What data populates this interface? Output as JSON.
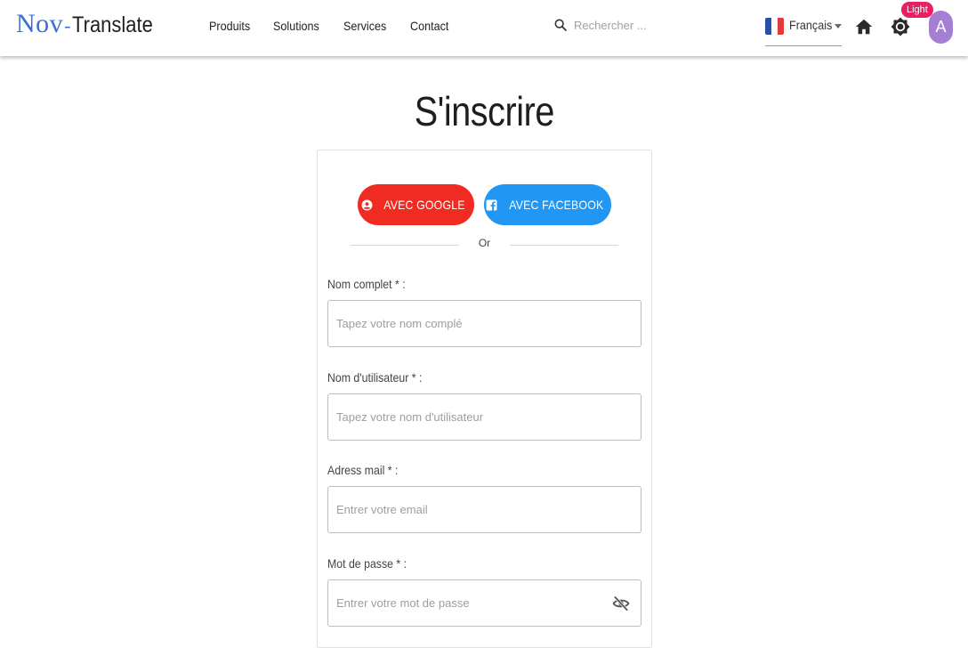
{
  "header": {
    "logo": {
      "part1": "Nov",
      "dash": "-",
      "part2": "Translate"
    },
    "nav": [
      "Produits",
      "Solutions",
      "Services",
      "Contact"
    ],
    "search": {
      "placeholder": "Rechercher ...",
      "icon": "search-icon"
    },
    "language": {
      "label": "Français",
      "flag_colors": [
        "#2d4fa3",
        "#ffffff",
        "#e23a3a"
      ]
    },
    "theme_badge": "Light",
    "avatar_letter": "A"
  },
  "page": {
    "title": "S'inscrire",
    "social": {
      "google_label": "AVEC GOOGLE",
      "facebook_label": "AVEC FACEBOOK",
      "google_color": "#ef2b22",
      "facebook_color": "#2196f3"
    },
    "divider_text": "Or",
    "fields": [
      {
        "label": "Nom complet * :",
        "placeholder": "Tapez votre nom complé"
      },
      {
        "label": "Nom d'utilisateur * :",
        "placeholder": "Tapez votre nom d'utilisateur"
      },
      {
        "label": "Adress mail * :",
        "placeholder": "Entrer votre email"
      },
      {
        "label": "Mot de passe * :",
        "placeholder": "Entrer votre mot de passe"
      }
    ]
  },
  "colors": {
    "accent": "#3b6fd4",
    "badge": "#e91e63",
    "avatar": "#a47fd2"
  }
}
